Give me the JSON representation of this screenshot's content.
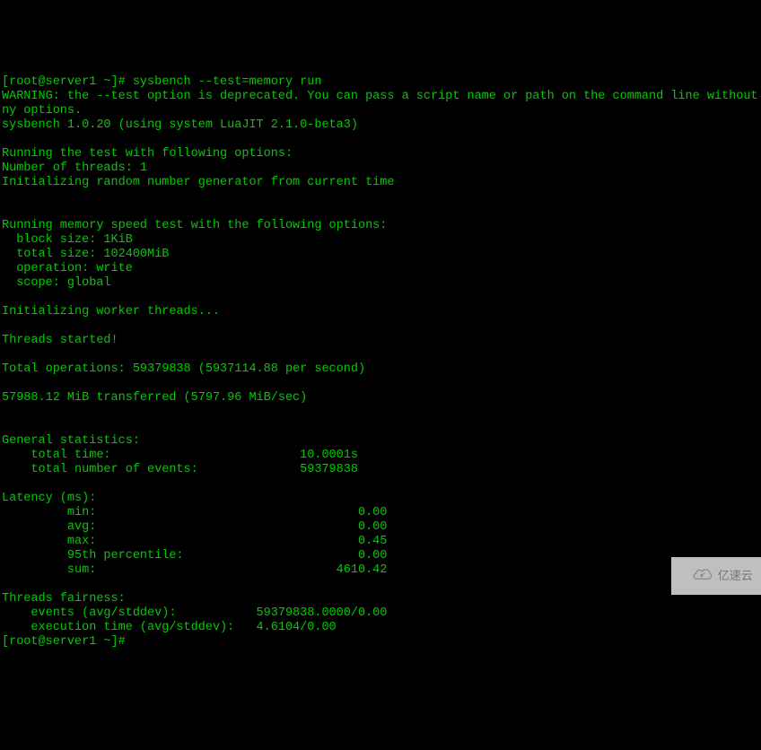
{
  "prompt1": "[root@server1 ~]# sysbench --test=memory run",
  "lines": [
    "WARNING: the --test option is deprecated. You can pass a script name or path on the command line without a",
    "ny options.",
    "sysbench 1.0.20 (using system LuaJIT 2.1.0-beta3)",
    "",
    "Running the test with following options:",
    "Number of threads: 1",
    "Initializing random number generator from current time",
    "",
    "",
    "Running memory speed test with the following options:",
    "  block size: 1KiB",
    "  total size: 102400MiB",
    "  operation: write",
    "  scope: global",
    "",
    "Initializing worker threads...",
    "",
    "Threads started!",
    "",
    "Total operations: 59379838 (5937114.88 per second)",
    "",
    "57988.12 MiB transferred (5797.96 MiB/sec)",
    "",
    "",
    "General statistics:",
    "    total time:                          10.0001s",
    "    total number of events:              59379838",
    "",
    "Latency (ms):",
    "         min:                                    0.00",
    "         avg:                                    0.00",
    "         max:                                    0.45",
    "         95th percentile:                        0.00",
    "         sum:                                 4610.42",
    "",
    "Threads fairness:",
    "    events (avg/stddev):           59379838.0000/0.00",
    "    execution time (avg/stddev):   4.6104/0.00",
    ""
  ],
  "prompt2": "[root@server1 ~]# ",
  "watermark_text": "亿速云"
}
